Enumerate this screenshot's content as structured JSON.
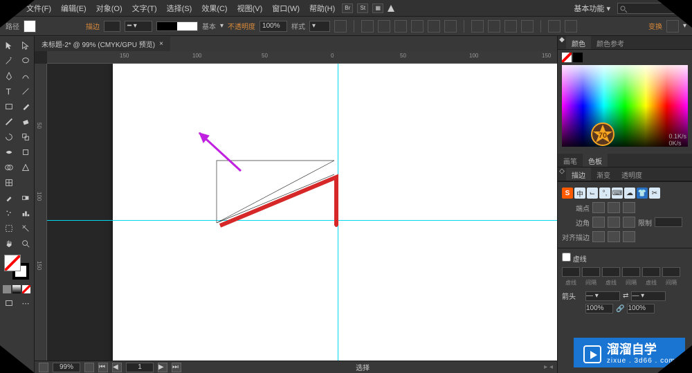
{
  "menu": {
    "items": [
      "文件(F)",
      "编辑(E)",
      "对象(O)",
      "文字(T)",
      "选择(S)",
      "效果(C)",
      "视图(V)",
      "窗口(W)",
      "帮助(H)"
    ],
    "layout_label": "基本功能",
    "mini_buttons": [
      "Br",
      "St"
    ]
  },
  "options": {
    "path_label": "路径",
    "stroke_label": "描边",
    "stroke_value": "",
    "stroke_style_label": "基本",
    "opacity_label": "不透明度",
    "opacity_value": "100%",
    "style_label": "样式",
    "transform_label": "变换"
  },
  "document": {
    "tab_title": "未标题-2* @ 99% (CMYK/GPU 预览)",
    "ruler_h": [
      "150",
      "100",
      "50",
      "0",
      "50",
      "100",
      "150"
    ],
    "ruler_v": [
      "50",
      "100",
      "150"
    ]
  },
  "status": {
    "zoom": "99%",
    "page": "1",
    "mode": "选择"
  },
  "panels": {
    "color_tabs": [
      "颜色",
      "颜色参考"
    ],
    "brush_tabs": [
      "画笔",
      "色板"
    ],
    "stroke_tabs": [
      "描边",
      "渐变",
      "透明度"
    ],
    "stroke": {
      "cap_label": "端点",
      "corner_label": "边角",
      "limit_label": "限制",
      "align_label": "对齐描边",
      "dash_header": "虚线",
      "dash_labels": [
        "虚线",
        "间隔",
        "虚线",
        "间隔",
        "虚线",
        "间隔"
      ],
      "arrow_label": "箭头",
      "scale_value": "100%"
    },
    "speed": {
      "down": "0.1K/s",
      "up": "0K/s"
    },
    "badge_center": "70",
    "ime": [
      "S",
      "中",
      "⌙",
      "°,",
      "⌨",
      "☁",
      "👕",
      "✂"
    ]
  },
  "watermark": {
    "title": "溜溜自学",
    "sub": "zixue . 3d66 . com"
  },
  "tools": [
    "selection",
    "direct-selection",
    "magic-wand",
    "lasso",
    "pen",
    "curvature",
    "type",
    "line",
    "rectangle",
    "paintbrush",
    "shaper",
    "eraser",
    "rotate",
    "scale",
    "width",
    "free-transform",
    "shape-builder",
    "perspective",
    "mesh",
    "gradient",
    "eyedropper",
    "blend",
    "symbol-sprayer",
    "column-graph",
    "artboard",
    "slice",
    "hand",
    "zoom"
  ]
}
